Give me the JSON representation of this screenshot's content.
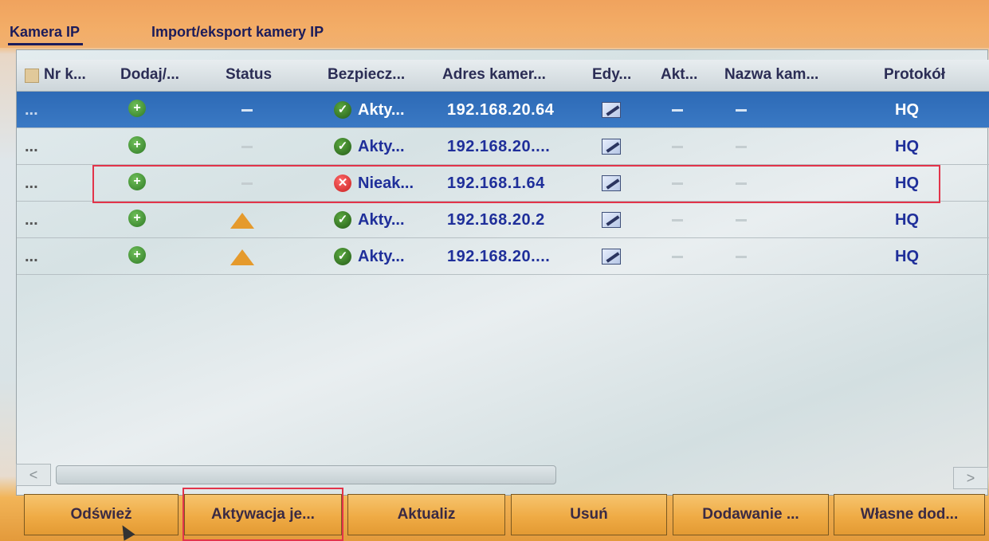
{
  "tabs": [
    {
      "label": "Kamera IP",
      "active": true
    },
    {
      "label": "Import/eksport kamery IP",
      "active": false
    }
  ],
  "table": {
    "headers": {
      "nr": "Nr k...",
      "add": "Dodaj/...",
      "status": "Status",
      "security": "Bezpiecz...",
      "address": "Adres kamer...",
      "edit": "Edy...",
      "act": "Akt...",
      "name": "Nazwa kam...",
      "protocol": "Protokół"
    },
    "rows": [
      {
        "nr": "...",
        "status_icon": "dash",
        "security": "Akty...",
        "security_state": "ok",
        "address": "192.168.20.64",
        "protocol": "HQ",
        "selected": true
      },
      {
        "nr": "...",
        "status_icon": "dash",
        "security": "Akty...",
        "security_state": "ok",
        "address": "192.168.20....",
        "protocol": "HQ",
        "selected": false
      },
      {
        "nr": "...",
        "status_icon": "dash",
        "security": "Nieak...",
        "security_state": "inactive",
        "address": "192.168.1.64",
        "protocol": "HQ",
        "selected": false
      },
      {
        "nr": "...",
        "status_icon": "warning",
        "security": "Akty...",
        "security_state": "ok",
        "address": "192.168.20.2",
        "protocol": "HQ",
        "selected": false
      },
      {
        "nr": "...",
        "status_icon": "warning",
        "security": "Akty...",
        "security_state": "ok",
        "address": "192.168.20....",
        "protocol": "HQ",
        "selected": false
      }
    ]
  },
  "scroll": {
    "left": "<",
    "right": ">"
  },
  "buttons": {
    "refresh": "Odśwież",
    "activate": "Aktywacja je...",
    "update": "Aktualiz",
    "delete": "Usuń",
    "add": "Dodawanie ...",
    "custom_add": "Własne dod..."
  },
  "colors": {
    "accent_blue": "#2d6ab6",
    "text_blue": "#1f2f9a",
    "highlight_red": "#e2344a",
    "button_orange": "#efab45"
  }
}
